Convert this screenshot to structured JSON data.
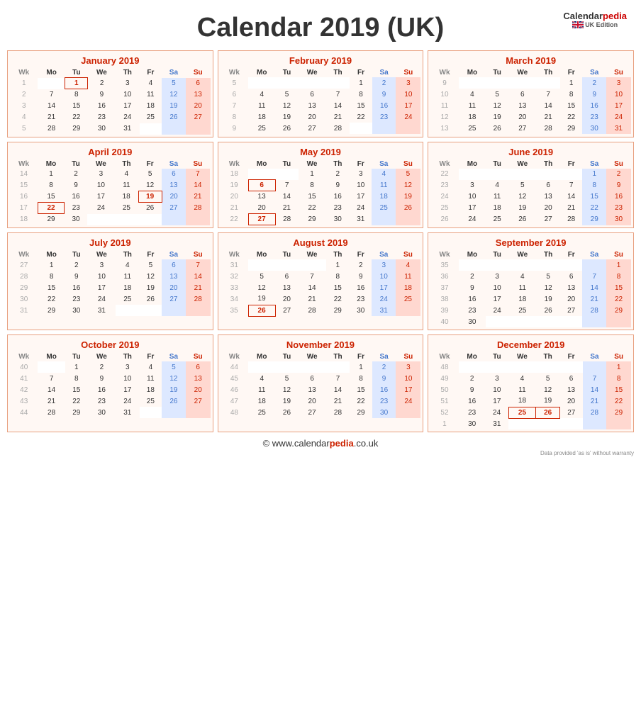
{
  "title": "Calendar 2019 (UK)",
  "logo": {
    "name": "Calendarpedia",
    "colored": "pedia",
    "edition": "UK Edition"
  },
  "footer": {
    "text": "© www.calendarpedia.co.uk",
    "colored": "pedia",
    "note": "Data provided 'as is' without warranty"
  },
  "months": [
    {
      "name": "January 2019",
      "weeks": [
        {
          "wk": "1",
          "mo": "",
          "tu": "1",
          "we": "2",
          "th": "3",
          "fr": "4",
          "sa": "5",
          "su": "6",
          "mo_h": false,
          "tu_h": true,
          "we_h": false,
          "th_h": false,
          "fr_h": false
        },
        {
          "wk": "2",
          "mo": "7",
          "tu": "8",
          "we": "9",
          "th": "10",
          "fr": "11",
          "sa": "12",
          "su": "13",
          "mo_h": false,
          "tu_h": false,
          "we_h": false,
          "th_h": false,
          "fr_h": false
        },
        {
          "wk": "3",
          "mo": "14",
          "tu": "15",
          "we": "16",
          "th": "17",
          "fr": "18",
          "sa": "19",
          "su": "20",
          "mo_h": false,
          "tu_h": false,
          "we_h": false,
          "th_h": false,
          "fr_h": false
        },
        {
          "wk": "4",
          "mo": "21",
          "tu": "22",
          "we": "23",
          "th": "24",
          "fr": "25",
          "sa": "26",
          "su": "27",
          "mo_h": false,
          "tu_h": false,
          "we_h": false,
          "th_h": false,
          "fr_h": false
        },
        {
          "wk": "5",
          "mo": "28",
          "tu": "29",
          "we": "30",
          "th": "31",
          "fr": "",
          "sa": "",
          "su": "",
          "mo_h": false,
          "tu_h": false,
          "we_h": false,
          "th_h": false,
          "fr_h": false
        }
      ]
    },
    {
      "name": "February 2019",
      "weeks": [
        {
          "wk": "5",
          "mo": "",
          "tu": "",
          "we": "",
          "th": "",
          "fr": "1",
          "sa": "2",
          "su": "3"
        },
        {
          "wk": "6",
          "mo": "4",
          "tu": "5",
          "we": "6",
          "th": "7",
          "fr": "8",
          "sa": "9",
          "su": "10"
        },
        {
          "wk": "7",
          "mo": "11",
          "tu": "12",
          "we": "13",
          "th": "14",
          "fr": "15",
          "sa": "16",
          "su": "17"
        },
        {
          "wk": "8",
          "mo": "18",
          "tu": "19",
          "we": "20",
          "th": "21",
          "fr": "22",
          "sa": "23",
          "su": "24"
        },
        {
          "wk": "9",
          "mo": "25",
          "tu": "26",
          "we": "27",
          "th": "28",
          "fr": "",
          "sa": "",
          "su": ""
        }
      ]
    },
    {
      "name": "March 2019",
      "weeks": [
        {
          "wk": "9",
          "mo": "",
          "tu": "",
          "we": "",
          "th": "",
          "fr": "1",
          "sa": "2",
          "su": "3"
        },
        {
          "wk": "10",
          "mo": "4",
          "tu": "5",
          "we": "6",
          "th": "7",
          "fr": "8",
          "sa": "9",
          "su": "10"
        },
        {
          "wk": "11",
          "mo": "11",
          "tu": "12",
          "we": "13",
          "th": "14",
          "fr": "15",
          "sa": "16",
          "su": "17"
        },
        {
          "wk": "12",
          "mo": "18",
          "tu": "19",
          "we": "20",
          "th": "21",
          "fr": "22",
          "sa": "23",
          "su": "24"
        },
        {
          "wk": "13",
          "mo": "25",
          "tu": "26",
          "we": "27",
          "th": "28",
          "fr": "29",
          "sa": "30",
          "su": "31"
        }
      ]
    },
    {
      "name": "April 2019",
      "weeks": [
        {
          "wk": "14",
          "mo": "1",
          "tu": "2",
          "we": "3",
          "th": "4",
          "fr": "5",
          "sa": "6",
          "su": "7"
        },
        {
          "wk": "15",
          "mo": "8",
          "tu": "9",
          "we": "10",
          "th": "11",
          "fr": "12",
          "sa": "13",
          "su": "14"
        },
        {
          "wk": "16",
          "mo": "15",
          "tu": "16",
          "we": "17",
          "th": "18",
          "fr": "19",
          "sa": "20",
          "su": "21"
        },
        {
          "wk": "17",
          "mo": "22",
          "tu": "23",
          "we": "24",
          "th": "25",
          "fr": "26",
          "sa": "27",
          "su": "28"
        },
        {
          "wk": "18",
          "mo": "29",
          "tu": "30",
          "we": "",
          "th": "",
          "fr": "",
          "sa": "",
          "su": ""
        }
      ]
    },
    {
      "name": "May 2019",
      "weeks": [
        {
          "wk": "18",
          "mo": "",
          "tu": "",
          "we": "1",
          "th": "2",
          "fr": "3",
          "sa": "4",
          "su": "5"
        },
        {
          "wk": "19",
          "mo": "6",
          "tu": "7",
          "we": "8",
          "th": "9",
          "fr": "10",
          "sa": "11",
          "su": "12"
        },
        {
          "wk": "20",
          "mo": "13",
          "tu": "14",
          "we": "15",
          "th": "16",
          "fr": "17",
          "sa": "18",
          "su": "19"
        },
        {
          "wk": "21",
          "mo": "20",
          "tu": "21",
          "we": "22",
          "th": "23",
          "fr": "24",
          "sa": "25",
          "su": "26"
        },
        {
          "wk": "22",
          "mo": "27",
          "tu": "28",
          "we": "29",
          "th": "30",
          "fr": "31",
          "sa": "",
          "su": ""
        }
      ]
    },
    {
      "name": "June 2019",
      "weeks": [
        {
          "wk": "22",
          "mo": "",
          "tu": "",
          "we": "",
          "th": "",
          "fr": "",
          "sa": "1",
          "su": "2"
        },
        {
          "wk": "23",
          "mo": "3",
          "tu": "4",
          "we": "5",
          "th": "6",
          "fr": "7",
          "sa": "8",
          "su": "9"
        },
        {
          "wk": "24",
          "mo": "10",
          "tu": "11",
          "we": "12",
          "th": "13",
          "fr": "14",
          "sa": "15",
          "su": "16"
        },
        {
          "wk": "25",
          "mo": "17",
          "tu": "18",
          "we": "19",
          "th": "20",
          "fr": "21",
          "sa": "22",
          "su": "23"
        },
        {
          "wk": "26",
          "mo": "24",
          "tu": "25",
          "we": "26",
          "th": "27",
          "fr": "28",
          "sa": "29",
          "su": "30"
        }
      ]
    },
    {
      "name": "July 2019",
      "weeks": [
        {
          "wk": "27",
          "mo": "1",
          "tu": "2",
          "we": "3",
          "th": "4",
          "fr": "5",
          "sa": "6",
          "su": "7"
        },
        {
          "wk": "28",
          "mo": "8",
          "tu": "9",
          "we": "10",
          "th": "11",
          "fr": "12",
          "sa": "13",
          "su": "14"
        },
        {
          "wk": "29",
          "mo": "15",
          "tu": "16",
          "we": "17",
          "th": "18",
          "fr": "19",
          "sa": "20",
          "su": "21"
        },
        {
          "wk": "30",
          "mo": "22",
          "tu": "23",
          "we": "24",
          "th": "25",
          "fr": "26",
          "sa": "27",
          "su": "28"
        },
        {
          "wk": "31",
          "mo": "29",
          "tu": "30",
          "we": "31",
          "th": "",
          "fr": "",
          "sa": "",
          "su": ""
        }
      ]
    },
    {
      "name": "August 2019",
      "weeks": [
        {
          "wk": "31",
          "mo": "",
          "tu": "",
          "we": "",
          "th": "1",
          "fr": "2",
          "sa": "3",
          "su": "4"
        },
        {
          "wk": "32",
          "mo": "5",
          "tu": "6",
          "we": "7",
          "th": "8",
          "fr": "9",
          "sa": "10",
          "su": "11"
        },
        {
          "wk": "33",
          "mo": "12",
          "tu": "13",
          "we": "14",
          "th": "15",
          "fr": "16",
          "sa": "17",
          "su": "18"
        },
        {
          "wk": "34",
          "mo": "19",
          "tu": "20",
          "we": "21",
          "th": "22",
          "fr": "23",
          "sa": "24",
          "su": "25"
        },
        {
          "wk": "35",
          "mo": "26",
          "tu": "27",
          "we": "28",
          "th": "29",
          "fr": "30",
          "sa": "31",
          "su": ""
        }
      ]
    },
    {
      "name": "September 2019",
      "weeks": [
        {
          "wk": "35",
          "mo": "",
          "tu": "",
          "we": "",
          "th": "",
          "fr": "",
          "sa": "",
          "su": "1"
        },
        {
          "wk": "36",
          "mo": "2",
          "tu": "3",
          "we": "4",
          "th": "5",
          "fr": "6",
          "sa": "7",
          "su": "8"
        },
        {
          "wk": "37",
          "mo": "9",
          "tu": "10",
          "we": "11",
          "th": "12",
          "fr": "13",
          "sa": "14",
          "su": "15"
        },
        {
          "wk": "38",
          "mo": "16",
          "tu": "17",
          "we": "18",
          "th": "19",
          "fr": "20",
          "sa": "21",
          "su": "22"
        },
        {
          "wk": "39",
          "mo": "23",
          "tu": "24",
          "we": "25",
          "th": "26",
          "fr": "27",
          "sa": "28",
          "su": "29"
        },
        {
          "wk": "40",
          "mo": "30",
          "tu": "",
          "we": "",
          "th": "",
          "fr": "",
          "sa": "",
          "su": ""
        }
      ]
    },
    {
      "name": "October 2019",
      "weeks": [
        {
          "wk": "40",
          "mo": "",
          "tu": "1",
          "we": "2",
          "th": "3",
          "fr": "4",
          "sa": "5",
          "su": "6"
        },
        {
          "wk": "41",
          "mo": "7",
          "tu": "8",
          "we": "9",
          "th": "10",
          "fr": "11",
          "sa": "12",
          "su": "13"
        },
        {
          "wk": "42",
          "mo": "14",
          "tu": "15",
          "we": "16",
          "th": "17",
          "fr": "18",
          "sa": "19",
          "su": "20"
        },
        {
          "wk": "43",
          "mo": "21",
          "tu": "22",
          "we": "23",
          "th": "24",
          "fr": "25",
          "sa": "26",
          "su": "27"
        },
        {
          "wk": "44",
          "mo": "28",
          "tu": "29",
          "we": "30",
          "th": "31",
          "fr": "",
          "sa": "",
          "su": ""
        }
      ]
    },
    {
      "name": "November 2019",
      "weeks": [
        {
          "wk": "44",
          "mo": "",
          "tu": "",
          "we": "",
          "th": "",
          "fr": "1",
          "sa": "2",
          "su": "3"
        },
        {
          "wk": "45",
          "mo": "4",
          "tu": "5",
          "we": "6",
          "th": "7",
          "fr": "8",
          "sa": "9",
          "su": "10"
        },
        {
          "wk": "46",
          "mo": "11",
          "tu": "12",
          "we": "13",
          "th": "14",
          "fr": "15",
          "sa": "16",
          "su": "17"
        },
        {
          "wk": "47",
          "mo": "18",
          "tu": "19",
          "we": "20",
          "th": "21",
          "fr": "22",
          "sa": "23",
          "su": "24"
        },
        {
          "wk": "48",
          "mo": "25",
          "tu": "26",
          "we": "27",
          "th": "28",
          "fr": "29",
          "sa": "30",
          "su": ""
        }
      ]
    },
    {
      "name": "December 2019",
      "weeks": [
        {
          "wk": "48",
          "mo": "",
          "tu": "",
          "we": "",
          "th": "",
          "fr": "",
          "sa": "",
          "su": "1"
        },
        {
          "wk": "49",
          "mo": "2",
          "tu": "3",
          "we": "4",
          "th": "5",
          "fr": "6",
          "sa": "7",
          "su": "8"
        },
        {
          "wk": "50",
          "mo": "9",
          "tu": "10",
          "we": "11",
          "th": "12",
          "fr": "13",
          "sa": "14",
          "su": "15"
        },
        {
          "wk": "51",
          "mo": "16",
          "tu": "17",
          "we": "18",
          "th": "19",
          "fr": "20",
          "sa": "21",
          "su": "22"
        },
        {
          "wk": "52",
          "mo": "23",
          "tu": "24",
          "we": "25",
          "th": "26",
          "fr": "27",
          "sa": "28",
          "su": "29"
        },
        {
          "wk": "1",
          "mo": "30",
          "tu": "31",
          "we": "",
          "th": "",
          "fr": "",
          "sa": "",
          "su": ""
        }
      ]
    }
  ],
  "holidays": {
    "jan": {
      "1": true
    },
    "apr": {
      "19": true,
      "22": true
    },
    "may": {
      "6": true,
      "27": true
    },
    "aug": {
      "26": true
    },
    "dec": {
      "25": true,
      "26": true
    }
  }
}
